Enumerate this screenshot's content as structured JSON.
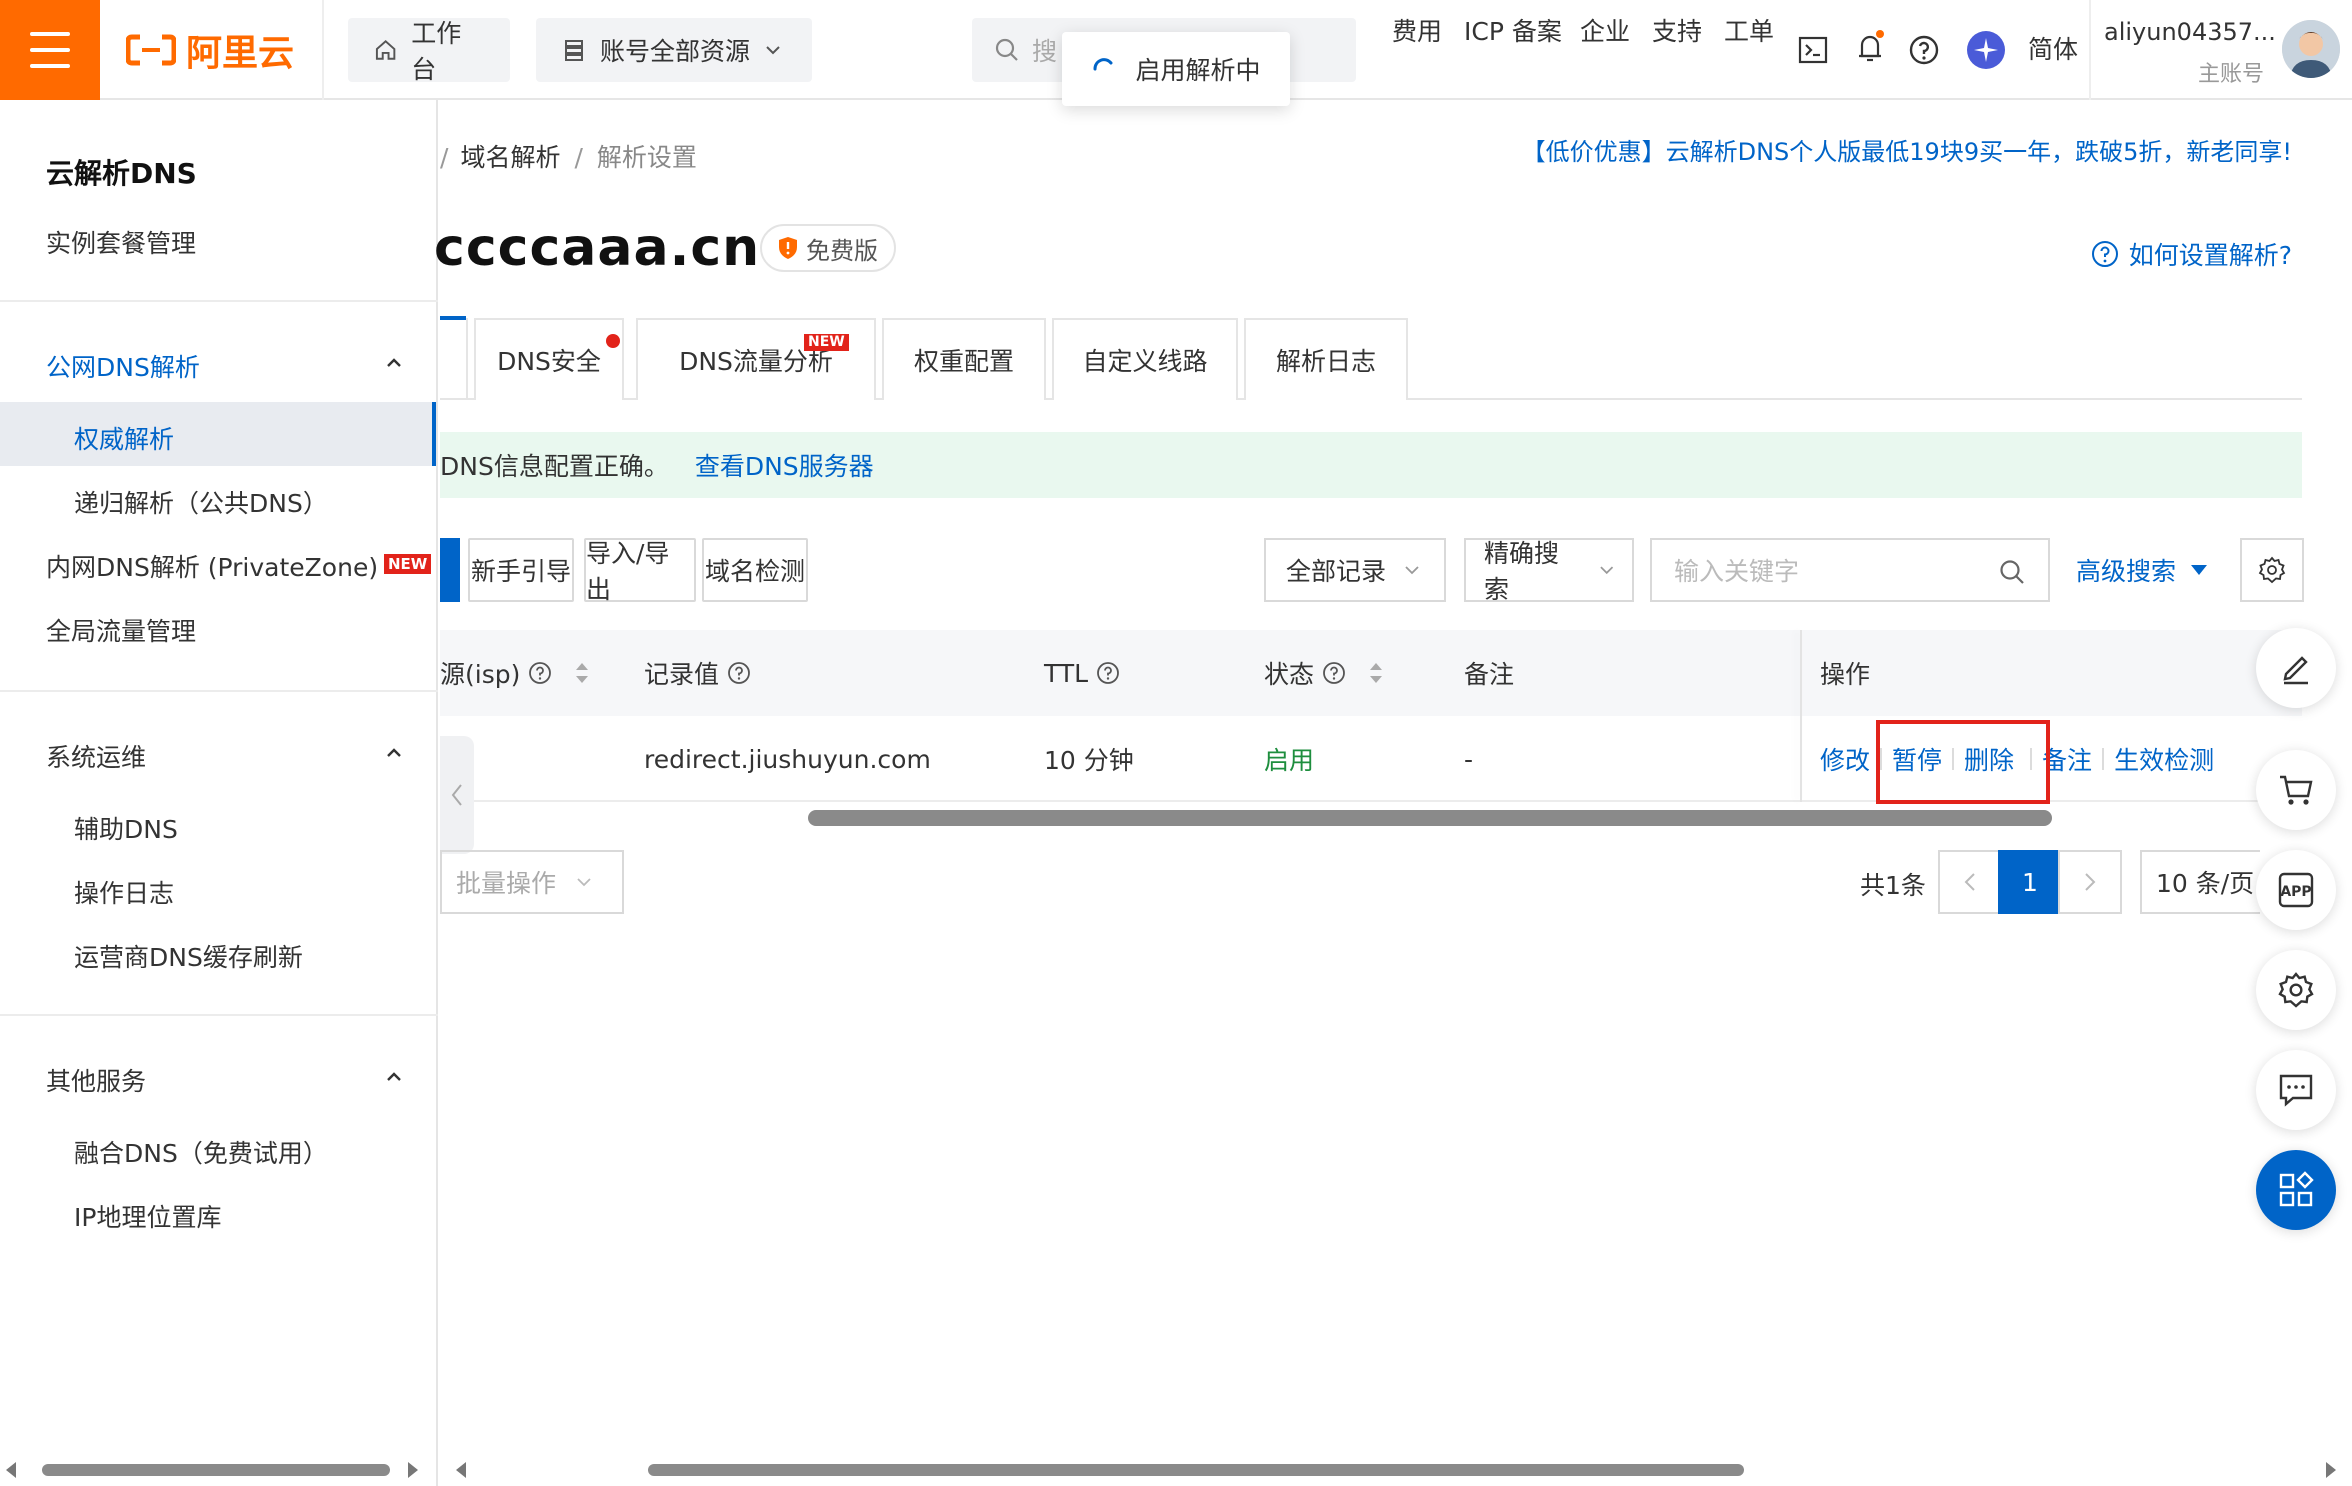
{
  "topbar": {
    "logo_text": "阿里云",
    "workbench": "工作台",
    "resources": "账号全部资源",
    "search_placeholder": "搜",
    "toast": "启用解析中",
    "nav": [
      "费用",
      "ICP 备案",
      "企业",
      "支持",
      "工单"
    ],
    "lang": "简体",
    "user_name": "aliyun04357...",
    "user_role": "主账号"
  },
  "sidebar": {
    "title": "云解析DNS",
    "instance": "实例套餐管理",
    "public_dns": "公网DNS解析",
    "authority": "权威解析",
    "recursive": "递归解析（公共DNS）",
    "private_zone": "内网DNS解析 (PrivateZone)",
    "new_badge": "NEW",
    "global_traffic": "全局流量管理",
    "sys_ops": "系统运维",
    "aux_dns": "辅助DNS",
    "op_log": "操作日志",
    "cache_refresh": "运营商DNS缓存刷新",
    "other": "其他服务",
    "fusion_dns": "融合DNS（免费试用）",
    "ip_geo": "IP地理位置库"
  },
  "main": {
    "breadcrumb": [
      "域名解析",
      "解析设置"
    ],
    "promo": "【低价优惠】云解析DNS个人版最低19块9买一年，跌破5折，新老同享!",
    "domain": "ccccaaa.cn",
    "plan_badge": "免费版",
    "help": "如何设置解析?",
    "tabs": [
      "DNS安全",
      "DNS流量分析",
      "权重配置",
      "自定义线路",
      "解析日志"
    ],
    "tab_new": "NEW",
    "notice_text": "DNS信息配置正确。",
    "notice_link": "查看DNS服务器",
    "toolbar": {
      "guide": "新手引导",
      "import": "导入/导出",
      "check": "域名检测",
      "all_records": "全部记录",
      "exact_search": "精确搜索",
      "keyword_placeholder": "输入关键字",
      "advanced": "高级搜索"
    },
    "table": {
      "headers": {
        "isp": "源(isp)",
        "value": "记录值",
        "ttl": "TTL",
        "status": "状态",
        "remark": "备注",
        "ops": "操作"
      },
      "rows": [
        {
          "value": "redirect.jiushuyun.com",
          "ttl": "10 分钟",
          "status": "启用",
          "remark": "-",
          "ops": [
            "修改",
            "暂停",
            "删除",
            "备注",
            "生效检测"
          ]
        }
      ]
    },
    "batch": "批量操作",
    "total": "共1条",
    "page": "1",
    "page_size": "10 条/页"
  },
  "colors": {
    "brand": "#ff6a00",
    "primary": "#0064c8",
    "success": "#1e8e3e",
    "highlight": "#e2231a"
  }
}
